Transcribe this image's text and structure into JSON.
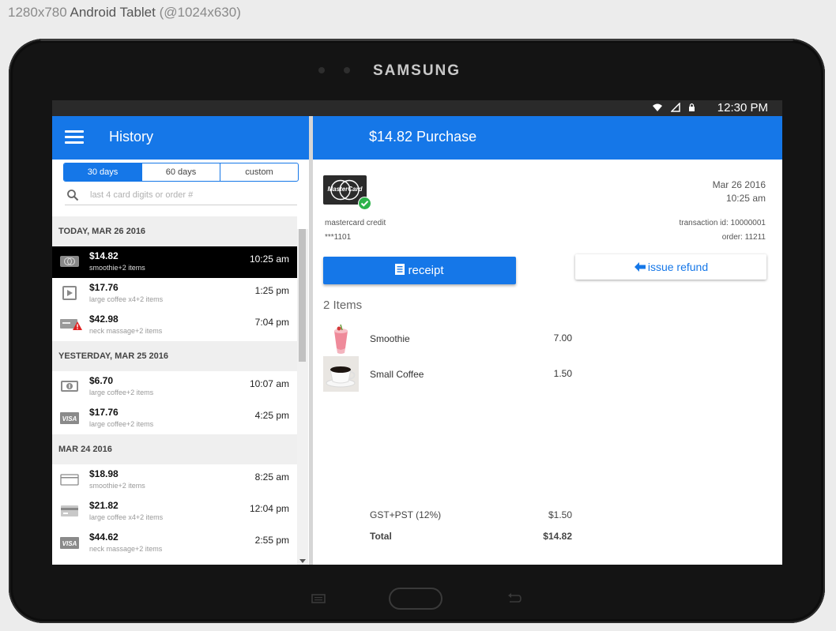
{
  "frame": {
    "caption_light": "1280x780",
    "caption_bold": "Android Tablet",
    "caption_tail": "(@1024x630)",
    "brand": "SAMSUNG"
  },
  "status_bar": {
    "time": "12:30 PM"
  },
  "history": {
    "title": "History",
    "ranges": [
      "30 days",
      "60 days",
      "custom"
    ],
    "selected_range": "30 days",
    "search_placeholder": "last 4 card digits or order #",
    "groups": [
      {
        "header": "TODAY, MAR 26 2016",
        "rows": [
          {
            "amount": "$14.82",
            "desc": "smoothie+2 items",
            "time": "10:25 am",
            "icon": "mastercard-icon",
            "selected": true
          },
          {
            "amount": "$17.76",
            "desc": "large coffee x4+2 items",
            "time": "1:25 pm",
            "icon": "play-card-icon"
          },
          {
            "amount": "$42.98",
            "desc": "neck massage+2 items",
            "time": "7:04 pm",
            "icon": "card-warning-icon"
          }
        ]
      },
      {
        "header": "YESTERDAY, MAR 25 2016",
        "rows": [
          {
            "amount": "$6.70",
            "desc": "large coffee+2 items",
            "time": "10:07 am",
            "icon": "cash-icon"
          },
          {
            "amount": "$17.76",
            "desc": "large coffee+2 items",
            "time": "4:25 pm",
            "icon": "visa-icon"
          }
        ]
      },
      {
        "header": "MAR 24 2016",
        "rows": [
          {
            "amount": "$18.98",
            "desc": "smoothie+2 items",
            "time": "8:25 am",
            "icon": "generic-card-icon"
          },
          {
            "amount": "$21.82",
            "desc": "large coffee x4+2 items",
            "time": "12:04 pm",
            "icon": "card-stripe-icon"
          },
          {
            "amount": "$44.62",
            "desc": "neck massage+2 items",
            "time": "2:55 pm",
            "icon": "visa-icon"
          }
        ]
      }
    ]
  },
  "purchase": {
    "title": "$14.82 Purchase",
    "card_logo_text": "MasterCard",
    "card_type": "mastercard credit",
    "card_number": "***1101",
    "date": "Mar 26 2016",
    "time": "10:25 am",
    "transaction_id": "transaction id: 10000001",
    "order": "order: 11211",
    "receipt_label": "receipt",
    "refund_label": "issue refund",
    "items_header": "2 Items",
    "items": [
      {
        "name": "Smoothie",
        "price": "7.00",
        "image": "smoothie-image"
      },
      {
        "name": "Small Coffee",
        "price": "1.50",
        "image": "coffee-image"
      }
    ],
    "tax_label": "GST+PST (12%)",
    "tax_value": "$1.50",
    "total_label": "Total",
    "total_value": "$14.82"
  },
  "colors": {
    "accent": "#1577e8",
    "selected_row": "#000000",
    "success": "#2cb34a",
    "warning": "#e02020"
  }
}
